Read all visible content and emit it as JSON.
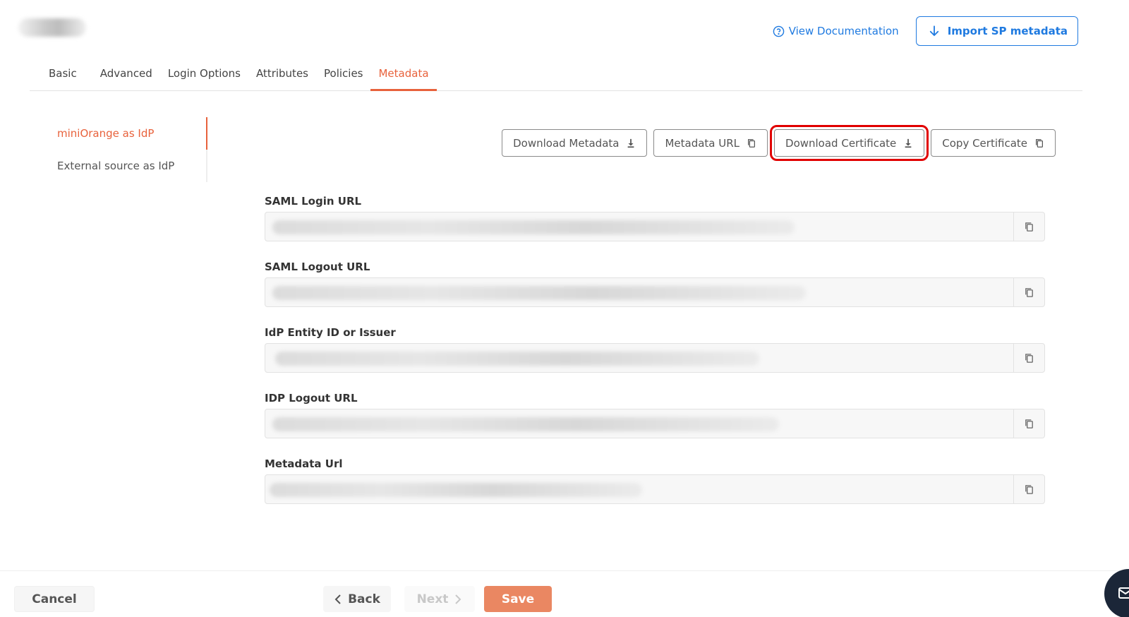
{
  "header": {
    "view_documentation": "View Documentation",
    "import_sp_metadata": "Import SP metadata"
  },
  "tabs": [
    {
      "label": "Basic"
    },
    {
      "label": "Advanced"
    },
    {
      "label": "Login Options"
    },
    {
      "label": "Attributes"
    },
    {
      "label": "Policies"
    },
    {
      "label": "Metadata",
      "active": true
    }
  ],
  "side_nav": {
    "items": [
      {
        "label": "miniOrange as IdP",
        "active": true
      },
      {
        "label": "External source as IdP"
      }
    ]
  },
  "actions": {
    "download_metadata": "Download Metadata",
    "metadata_url": "Metadata URL",
    "download_certificate": "Download Certificate",
    "copy_certificate": "Copy Certificate"
  },
  "fields": [
    {
      "label": "SAML Login URL",
      "value": ""
    },
    {
      "label": "SAML Logout URL",
      "value": ""
    },
    {
      "label": "IdP Entity ID or Issuer",
      "value": ""
    },
    {
      "label": "IDP Logout URL",
      "value": ""
    },
    {
      "label": "Metadata Url",
      "value": ""
    }
  ],
  "footer": {
    "cancel": "Cancel",
    "back": "Back",
    "next": "Next",
    "save": "Save"
  },
  "colors": {
    "accent": "#e8623c",
    "link": "#1f7ae0",
    "highlight": "#e10000",
    "save": "#ea8762"
  },
  "icons": {
    "help": "help-circle-icon",
    "import": "arrow-down-icon",
    "download": "download-icon",
    "copy": "copy-icon",
    "back": "chevron-left-icon",
    "next": "chevron-right-icon",
    "chat": "mail-icon"
  }
}
